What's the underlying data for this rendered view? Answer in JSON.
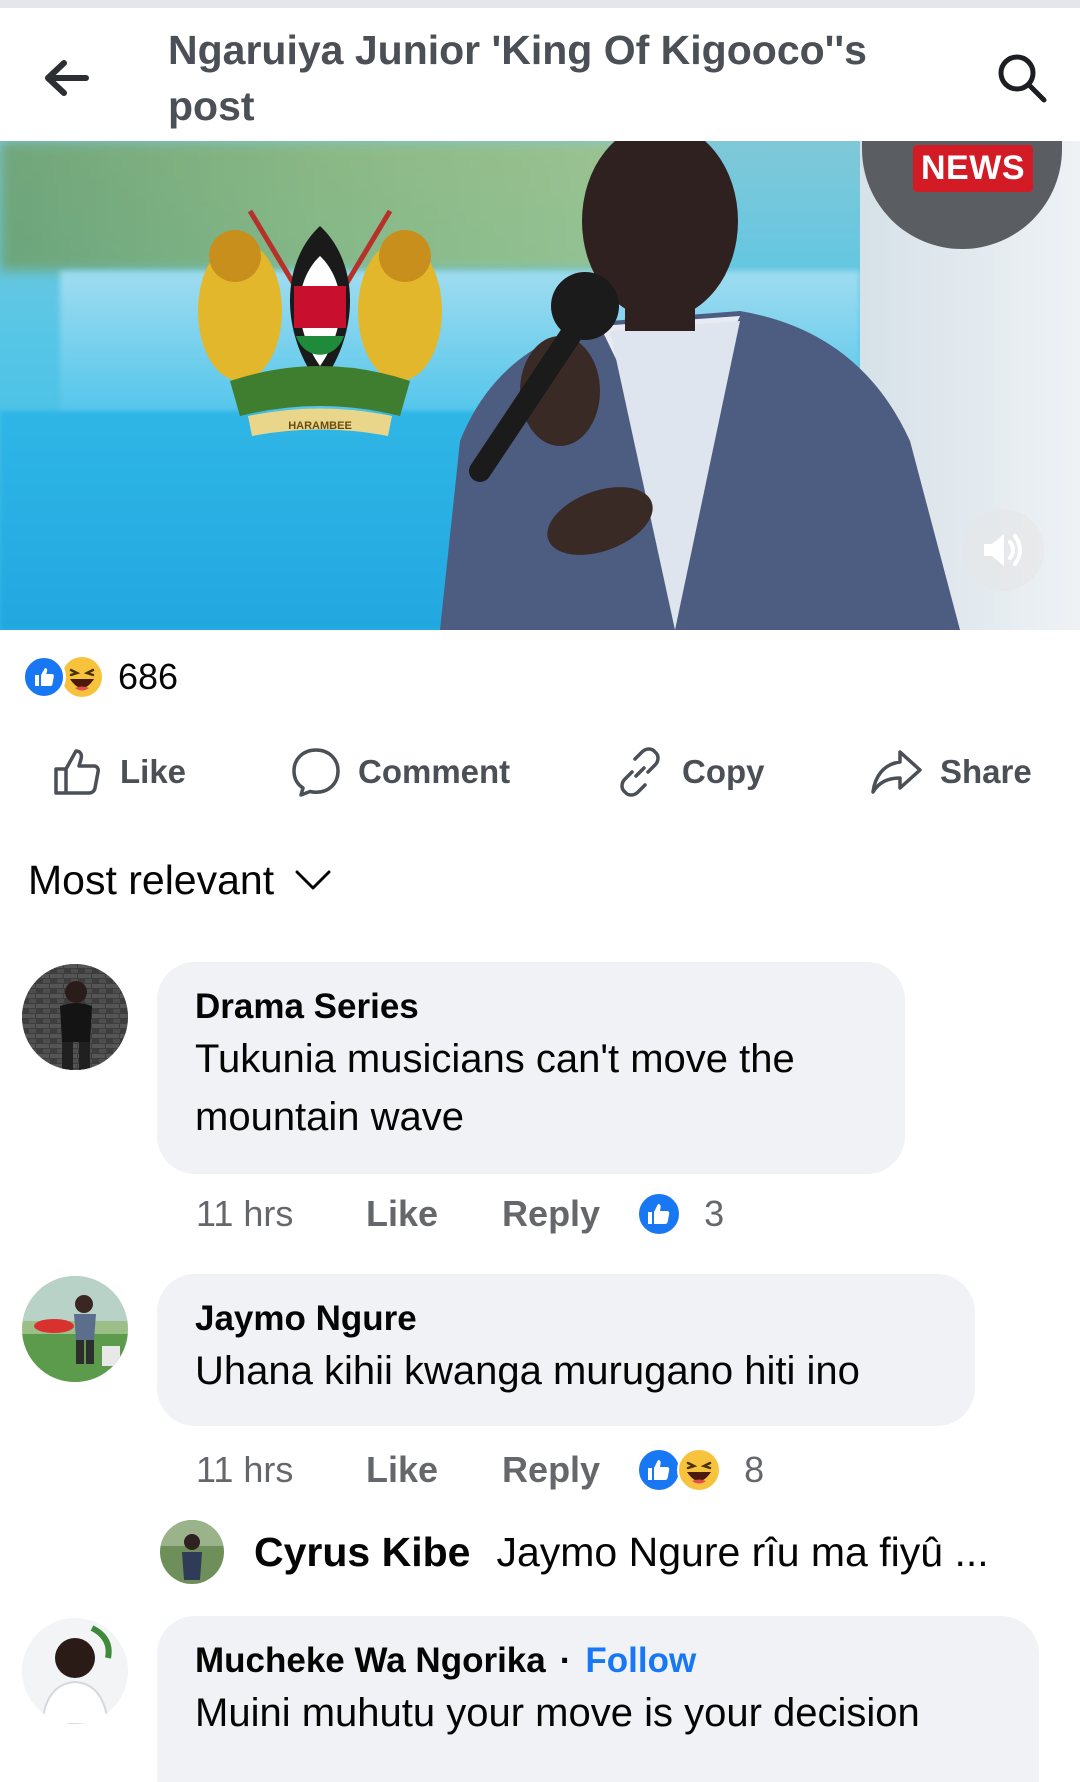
{
  "header": {
    "title": "Ngaruiya Junior 'King Of Kigooco''s post"
  },
  "video": {
    "news_label": "NEWS",
    "emblem_text": "HARAMBEE"
  },
  "reactions": {
    "count": "686"
  },
  "actions": {
    "like": "Like",
    "comment": "Comment",
    "copy": "Copy",
    "share": "Share"
  },
  "sort": {
    "label": "Most relevant"
  },
  "comments": [
    {
      "name": "Drama Series",
      "text_line1": "Tukunia musicians can't move the",
      "text_line2": "mountain wave",
      "time": "11 hrs",
      "like": "Like",
      "reply": "Reply",
      "reaction_count": "3"
    },
    {
      "name": "Jaymo Ngure",
      "text": "Uhana kihii kwanga murugano hiti ino",
      "time": "11 hrs",
      "like": "Like",
      "reply": "Reply",
      "reaction_count": "8"
    },
    {
      "name": "Mucheke Wa Ngorika",
      "follow": "Follow",
      "text": "Muini muhutu your move is your decision"
    }
  ],
  "reply_preview": {
    "name": "Cyrus Kibe",
    "text": "Jaymo Ngure rîu ma fiyû ..."
  },
  "colors": {
    "accent": "#1877f2",
    "bubble": "#f0f2f5",
    "secondary_text": "#65676b",
    "news_red": "#d31b25"
  }
}
